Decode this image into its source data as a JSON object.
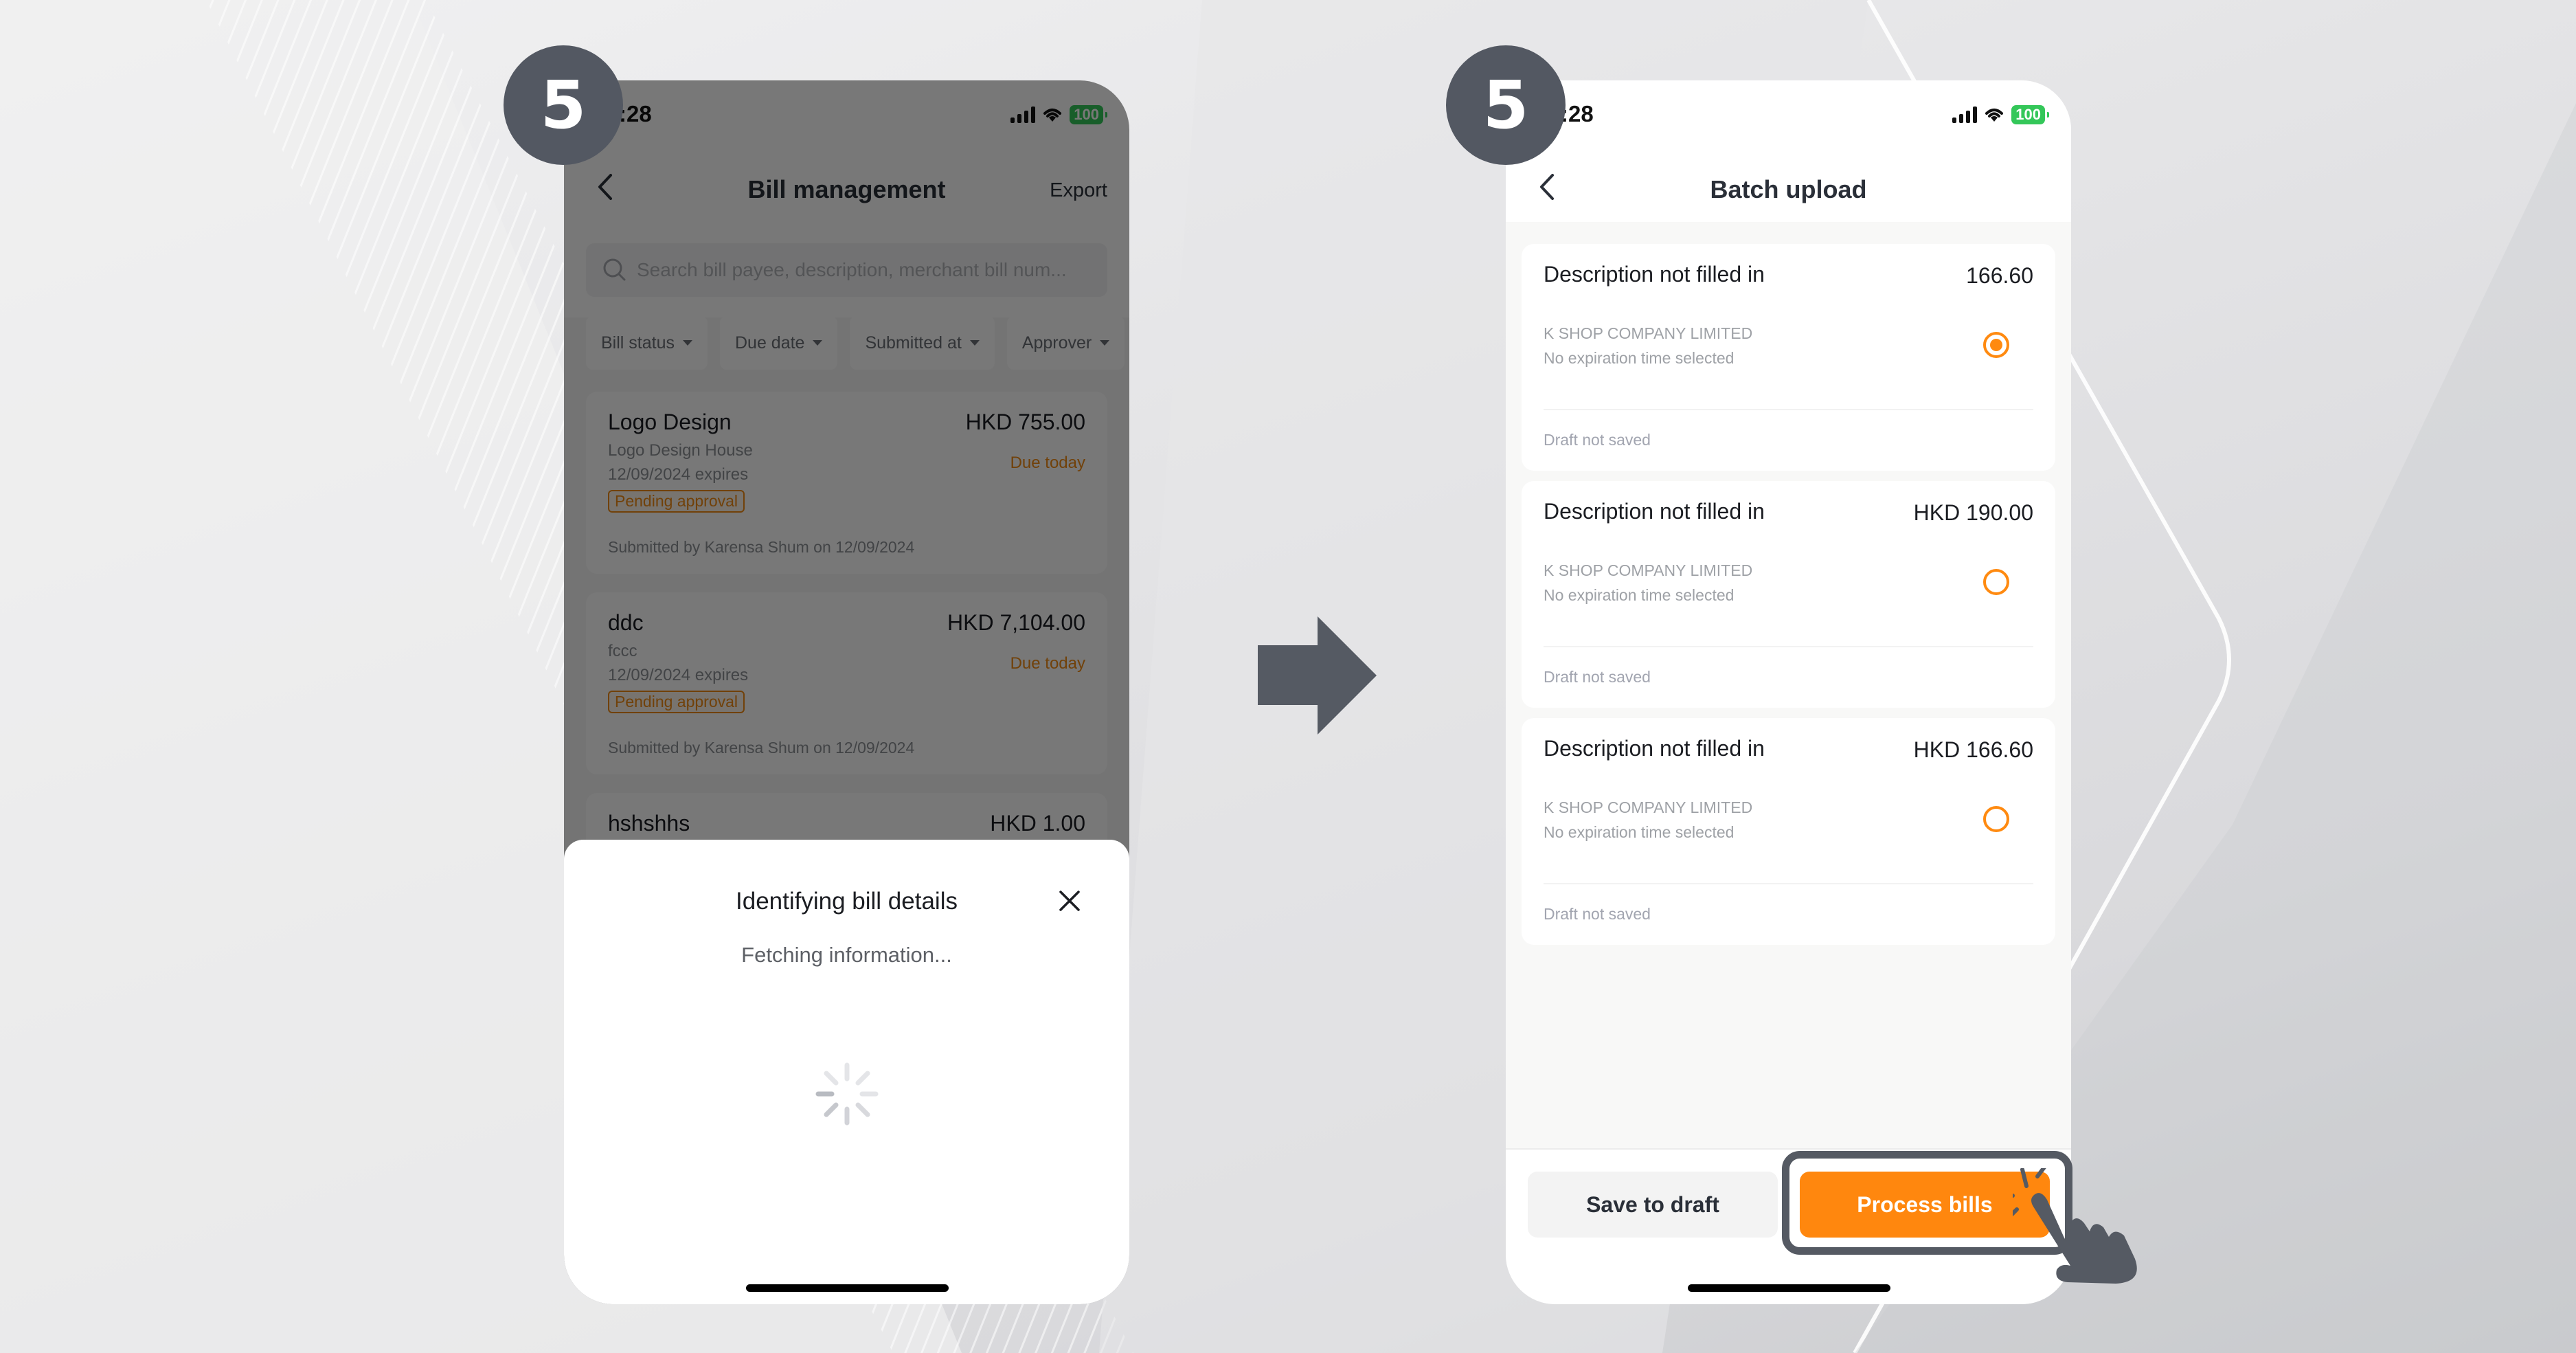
{
  "step_number": "5",
  "colors": {
    "accent_orange": "#ff870e",
    "badge_gray": "#535862",
    "battery_green": "#34c759"
  },
  "left_screen": {
    "status_bar": {
      "time": ":28",
      "battery": "100",
      "icons": [
        "signal-icon",
        "wifi-icon",
        "battery-icon"
      ]
    },
    "nav": {
      "title": "Bill management",
      "action": "Export",
      "back_icon": "chevron-left-icon"
    },
    "search": {
      "placeholder": "Search bill payee, description, merchant bill num...",
      "icon": "search-icon"
    },
    "filters": [
      "Bill status",
      "Due date",
      "Submitted at",
      "Approver"
    ],
    "bills": [
      {
        "title": "Logo Design",
        "amount": "HKD 755.00",
        "payee": "Logo Design House",
        "expires": "12/09/2024 expires",
        "due": "Due today",
        "status": "Pending approval",
        "submitted": "Submitted by Karensa Shum on 12/09/2024"
      },
      {
        "title": "ddc",
        "amount": "HKD 7,104.00",
        "payee": "fccc",
        "expires": "12/09/2024 expires",
        "due": "Due today",
        "status": "Pending approval",
        "submitted": "Submitted by Karensa Shum on 12/09/2024"
      },
      {
        "title": "hshshhs",
        "amount": "HKD 1.00"
      }
    ],
    "sheet": {
      "title": "Identifying bill details",
      "subtitle": "Fetching information...",
      "close_icon": "close-icon",
      "loading_icon": "spinner-icon"
    }
  },
  "right_screen": {
    "status_bar": {
      "time": ":28",
      "battery": "100",
      "icons": [
        "signal-icon",
        "wifi-icon",
        "battery-icon"
      ]
    },
    "nav": {
      "title": "Batch upload",
      "back_icon": "chevron-left-icon"
    },
    "bills": [
      {
        "description": "Description not filled in",
        "amount": "166.60",
        "company": "K SHOP COMPANY LIMITED",
        "expiration": "No expiration time selected",
        "draft_status": "Draft not saved",
        "selected": true
      },
      {
        "description": "Description not filled in",
        "amount": "HKD 190.00",
        "company": "K SHOP COMPANY LIMITED",
        "expiration": "No expiration time selected",
        "draft_status": "Draft not saved",
        "selected": false
      },
      {
        "description": "Description not filled in",
        "amount": "HKD 166.60",
        "company": "K SHOP COMPANY LIMITED",
        "expiration": "No expiration time selected",
        "draft_status": "Draft not saved",
        "selected": false
      }
    ],
    "footer": {
      "save_label": "Save to draft",
      "process_label": "Process bills"
    }
  },
  "annotations": {
    "flow_arrow": "arrow-right-icon",
    "pointer": "hand-pointer-icon",
    "highlighted_control": "Process bills"
  }
}
